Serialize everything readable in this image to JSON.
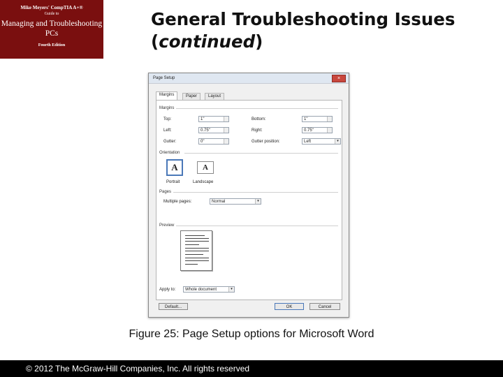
{
  "badge": {
    "line1": "Mike Meyers' CompTIA A+®",
    "line2": "Guide to",
    "line3": "Managing and Troubleshooting PCs",
    "line4": "Fourth Edition"
  },
  "title": {
    "main": "General Troubleshooting Issues",
    "open": "(",
    "italic": "continued",
    "close": ")"
  },
  "dialog": {
    "title": "Page Setup",
    "close": "×",
    "tabs": [
      "Margins",
      "Paper",
      "Layout"
    ],
    "margins_section": "Margins",
    "top_label": "Top:",
    "top_value": "1\"",
    "bottom_label": "Bottom:",
    "bottom_value": "1\"",
    "left_label": "Left:",
    "left_value": "0.75\"",
    "right_label": "Right:",
    "right_value": "0.75\"",
    "gutter_label": "Gutter:",
    "gutter_value": "0\"",
    "gutter_pos_label": "Gutter position:",
    "gutter_pos_value": "Left",
    "orientation_section": "Orientation",
    "portrait": "Portrait",
    "landscape": "Landscape",
    "orient_glyph": "A",
    "pages_section": "Pages",
    "multiple_label": "Multiple pages:",
    "multiple_value": "Normal",
    "preview_section": "Preview",
    "apply_label": "Apply to:",
    "apply_value": "Whole document",
    "default_btn": "Default...",
    "ok_btn": "OK",
    "cancel_btn": "Cancel"
  },
  "caption": "Figure 25: Page Setup options for Microsoft Word",
  "footer": "© 2012 The McGraw-Hill Companies, Inc. All rights reserved",
  "colors": {
    "badge_bg": "#7a0f0f",
    "footer_bg": "#000000",
    "selection": "#4a78b8"
  }
}
